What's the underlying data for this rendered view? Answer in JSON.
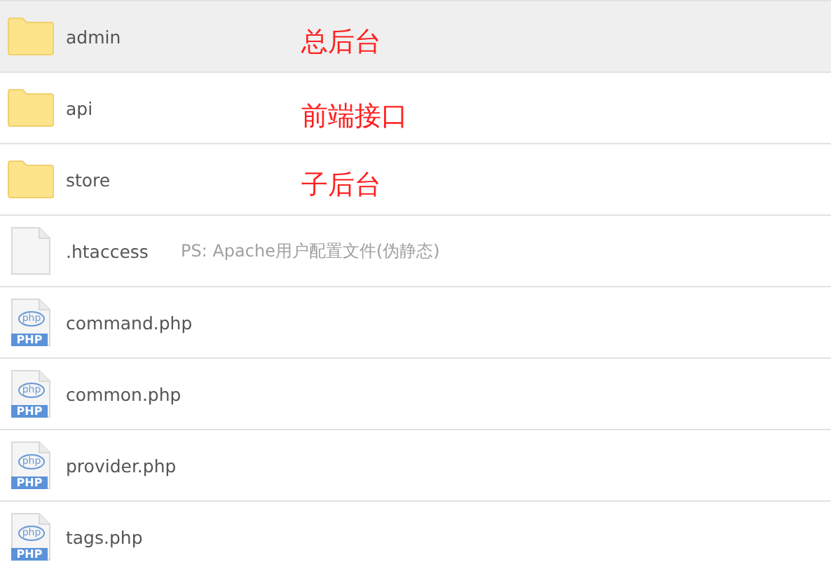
{
  "files": [
    {
      "kind": "folder",
      "name": "admin",
      "selected": true,
      "annotation": "总后台"
    },
    {
      "kind": "folder",
      "name": "api",
      "selected": false,
      "annotation": "前端接口"
    },
    {
      "kind": "folder",
      "name": "store",
      "selected": false,
      "annotation": "子后台"
    },
    {
      "kind": "file",
      "name": ".htaccess",
      "selected": false,
      "note": "PS: Apache用户配置文件(伪静态)"
    },
    {
      "kind": "php",
      "name": "command.php",
      "selected": false,
      "icon_logo": "php",
      "icon_label": "PHP"
    },
    {
      "kind": "php",
      "name": "common.php",
      "selected": false,
      "icon_logo": "php",
      "icon_label": "PHP"
    },
    {
      "kind": "php",
      "name": "provider.php",
      "selected": false,
      "icon_logo": "php",
      "icon_label": "PHP"
    },
    {
      "kind": "php",
      "name": "tags.php",
      "selected": false,
      "icon_logo": "php",
      "icon_label": "PHP"
    }
  ]
}
